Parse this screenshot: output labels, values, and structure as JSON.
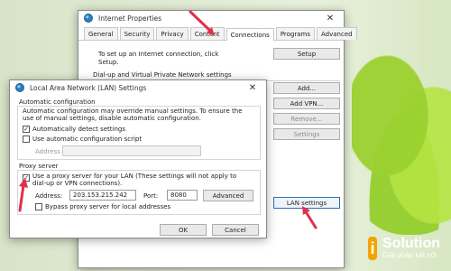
{
  "internet_properties": {
    "title": "Internet Properties",
    "tabs": [
      "General",
      "Security",
      "Privacy",
      "Content",
      "Connections",
      "Programs",
      "Advanced"
    ],
    "active_tab": "Connections",
    "setup_text_line1": "To set up an Internet connection, click",
    "setup_text_line2": "Setup.",
    "setup_button": "Setup",
    "dialup_heading": "Dial-up and Virtual Private Network settings",
    "add_button": "Add...",
    "add_vpn_button": "Add VPN...",
    "remove_button": "Remove...",
    "settings_button": "Settings",
    "lan_settings_button": "LAN settings"
  },
  "lan_dialog": {
    "title": "Local Area Network (LAN) Settings",
    "auto_config_heading": "Automatic configuration",
    "auto_config_desc_line1": "Automatic configuration may override manual settings. To ensure the",
    "auto_config_desc_line2": "use of manual settings, disable automatic configuration.",
    "auto_detect_label": "Automatically detect settings",
    "auto_detect_checked": true,
    "use_script_label": "Use automatic configuration script",
    "use_script_checked": false,
    "address_label": "Address",
    "proxy_heading": "Proxy server",
    "use_proxy_line1": "Use a proxy server for your LAN (These settings will not apply to",
    "use_proxy_line2": "dial-up or VPN connections).",
    "use_proxy_checked": true,
    "proxy_address_label": "Address:",
    "proxy_address_value": "203.153.215.242",
    "port_label": "Port:",
    "port_value": "8080",
    "advanced_button": "Advanced",
    "bypass_label": "Bypass proxy server for local addresses",
    "bypass_checked": false,
    "ok_button": "OK",
    "cancel_button": "Cancel"
  },
  "branding": {
    "logo_letter": "i",
    "name": "Solution",
    "tagline": "Giải pháp kết nối"
  },
  "colors": {
    "accent_red": "#e0304b",
    "brand_orange": "#f2a400"
  }
}
